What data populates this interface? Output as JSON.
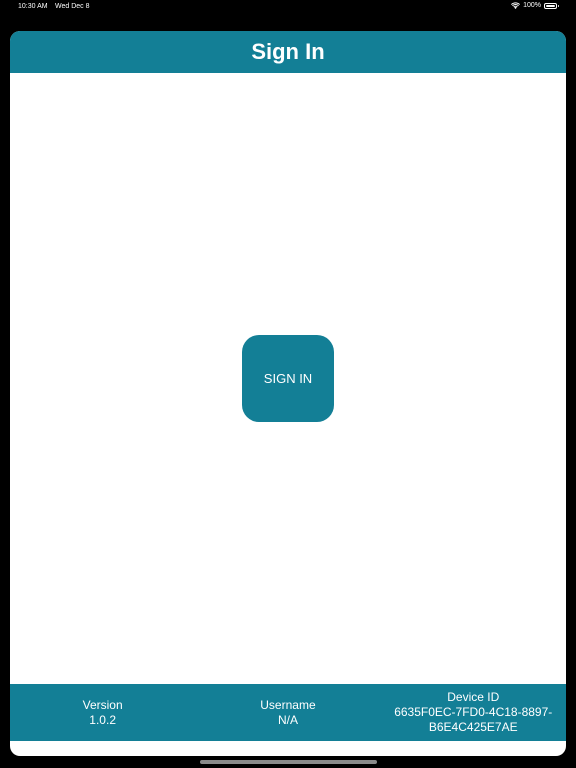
{
  "status_bar": {
    "time": "10:30 AM",
    "date": "Wed Dec 8",
    "battery": "100%",
    "icons": [
      "wifi-icon",
      "battery-icon"
    ]
  },
  "nav": {
    "title": "Sign In"
  },
  "main": {
    "sign_in_label": "SIGN IN"
  },
  "footer": {
    "version_label": "Version",
    "version_value": "1.0.2",
    "username_label": "Username",
    "username_value": "N/A",
    "device_label": "Device ID",
    "device_value_line1": "6635F0EC-7FD0-4C18-8897-",
    "device_value_line2": "B6E4C425E7AE"
  },
  "colors": {
    "accent": "#137f96",
    "background": "#ffffff",
    "frame": "#000000"
  }
}
